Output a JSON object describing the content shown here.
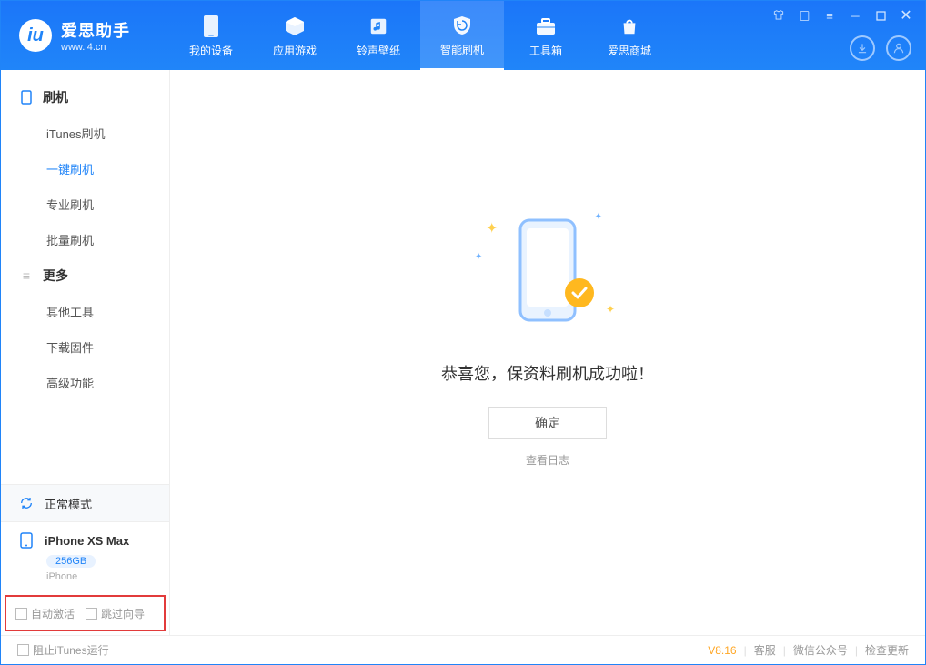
{
  "app": {
    "name_cn": "爱思助手",
    "name_en": "www.i4.cn"
  },
  "tabs": [
    {
      "label": "我的设备"
    },
    {
      "label": "应用游戏"
    },
    {
      "label": "铃声壁纸"
    },
    {
      "label": "智能刷机"
    },
    {
      "label": "工具箱"
    },
    {
      "label": "爱思商城"
    }
  ],
  "sidebar": {
    "group1_title": "刷机",
    "group1_items": [
      {
        "label": "iTunes刷机"
      },
      {
        "label": "一键刷机"
      },
      {
        "label": "专业刷机"
      },
      {
        "label": "批量刷机"
      }
    ],
    "group2_title": "更多",
    "group2_items": [
      {
        "label": "其他工具"
      },
      {
        "label": "下载固件"
      },
      {
        "label": "高级功能"
      }
    ]
  },
  "device": {
    "mode": "正常模式",
    "name": "iPhone XS Max",
    "storage": "256GB",
    "type": "iPhone"
  },
  "options": {
    "auto_activate": "自动激活",
    "skip_wizard": "跳过向导"
  },
  "main": {
    "success_text": "恭喜您，保资料刷机成功啦！",
    "ok_button": "确定",
    "view_log": "查看日志"
  },
  "footer": {
    "stop_itunes": "阻止iTunes运行",
    "version": "V8.16",
    "customer_service": "客服",
    "wechat": "微信公众号",
    "check_update": "检查更新"
  }
}
